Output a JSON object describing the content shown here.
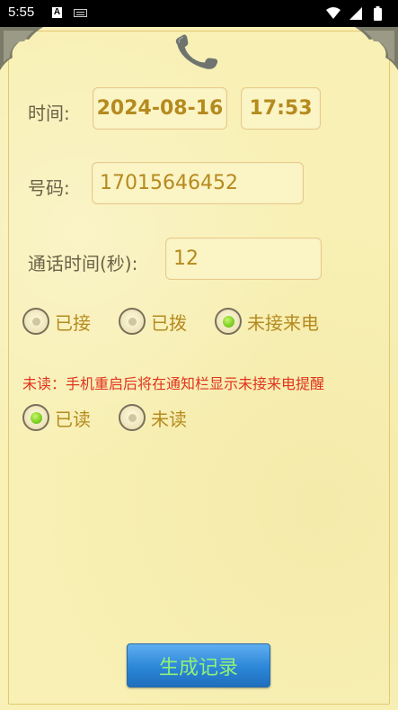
{
  "status_bar": {
    "time": "5:55",
    "a_icon_label": "A"
  },
  "form": {
    "time_label": "时间:",
    "date_value": "2024-08-16",
    "time_value": "17:53",
    "number_label": "号码:",
    "number_value": "17015646452",
    "duration_label": "通话时间(秒):",
    "duration_value": "12"
  },
  "call_type": {
    "options": [
      "已接",
      "已拨",
      "未接来电"
    ],
    "selected": "未接来电"
  },
  "note": "未读：手机重启后将在通知栏显示未接来电提醒",
  "read_status": {
    "options": [
      "已读",
      "未读"
    ],
    "selected": "已读"
  },
  "generate_button_label": "生成记录",
  "colors": {
    "accent_text": "#b58a1f",
    "note_text": "#e0341d",
    "button": "#2c86d7",
    "button_text": "#8ff07a"
  }
}
